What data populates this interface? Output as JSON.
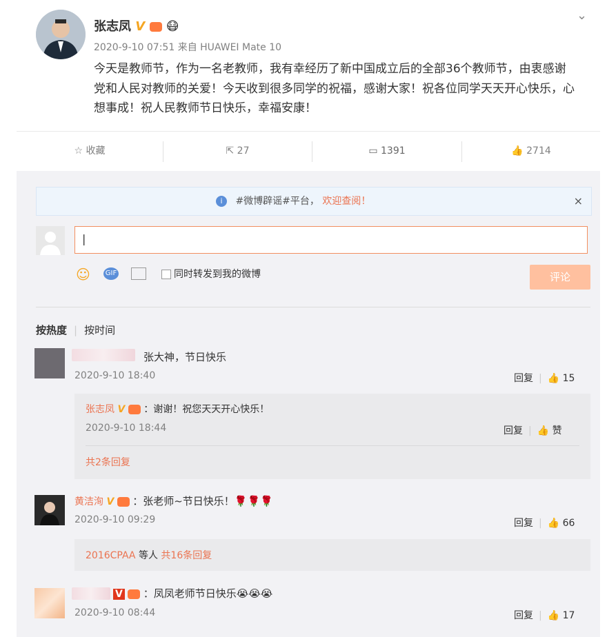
{
  "post": {
    "author": "张志凤",
    "verified_badge": "V",
    "meta": "2020-9-10 07:51 来自 HUAWEI Mate 10",
    "content": "今天是教师节，作为一名老教师，我有幸经历了新中国成立后的全部36个教师节，由衷感谢党和人民对教师的关爱！今天收到很多同学的祝福，感谢大家！祝各位同学天天开心快乐，心想事成！祝人民教师节日快乐，幸福安康！"
  },
  "actions": {
    "favorite": "收藏",
    "forward": "27",
    "comment": "1391",
    "like": "2714"
  },
  "notice": {
    "text": "#微博辟谣#平台，",
    "link": "欢迎查阅！",
    "close": "×"
  },
  "composer": {
    "input_value": "|",
    "also_repost_label": "同时转发到我的微博",
    "submit_label": "评论"
  },
  "sort": {
    "hot": "按热度",
    "time": "按时间"
  },
  "comments": [
    {
      "text": "张大神，节日快乐",
      "time": "2020-9-10 18:40",
      "reply_label": "回复",
      "likes": "15",
      "reply": {
        "name": "张志凤",
        "verified_badge": "V",
        "text": "：谢谢！祝您天天开心快乐！",
        "time": "2020-9-10 18:44",
        "reply_label": "回复",
        "like_label": "赞"
      },
      "more_replies": "共2条回复"
    },
    {
      "name": "黄洁洵",
      "verified_badge": "V",
      "text": "：张老师~节日快乐！🌹🌹🌹",
      "time": "2020-9-10 09:29",
      "reply_label": "回复",
      "likes": "66",
      "more_prefix": "2016CPAA",
      "more_mid": " 等人 ",
      "more_replies": "共16条回复"
    },
    {
      "verified_badge": "V",
      "text": "：凤凤老师节日快乐😭😭😭",
      "time": "2020-9-10 08:44",
      "reply_label": "回复",
      "likes": "17"
    }
  ],
  "colors": {
    "accent": "#eb7350",
    "verified": "#f5a623",
    "submit_disabled": "#ffc09f",
    "notice_bg": "#eef5fc"
  }
}
